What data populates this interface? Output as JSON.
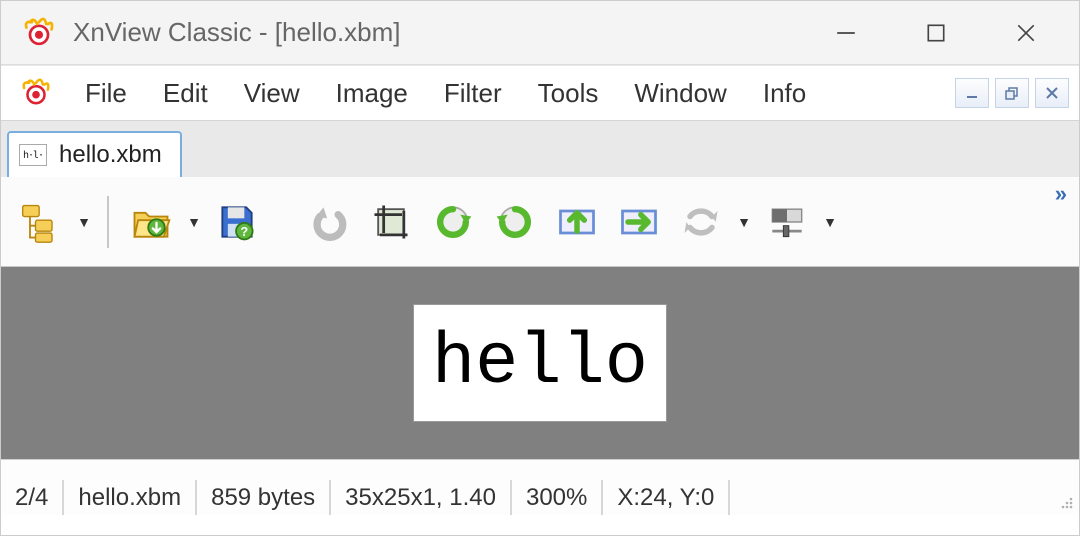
{
  "window": {
    "title": "XnView Classic - [hello.xbm]"
  },
  "menu": {
    "items": [
      "File",
      "Edit",
      "View",
      "Image",
      "Filter",
      "Tools",
      "Window",
      "Info"
    ]
  },
  "tabs": {
    "active": {
      "label": "hello.xbm"
    }
  },
  "toolbar": {
    "icons": [
      "browse-tree-icon",
      "open-folder-icon",
      "save-icon",
      "undo-icon",
      "crop-icon",
      "rotate-ccw-icon",
      "rotate-cw-icon",
      "flip-up-icon",
      "flip-right-icon",
      "refresh-icon",
      "slider-icon"
    ]
  },
  "image": {
    "content_text": "hello"
  },
  "status": {
    "index": "2/4",
    "filename": "hello.xbm",
    "filesize": "859 bytes",
    "dimensions": "35x25x1, 1.40",
    "zoom": "300%",
    "cursor": "X:24, Y:0"
  }
}
